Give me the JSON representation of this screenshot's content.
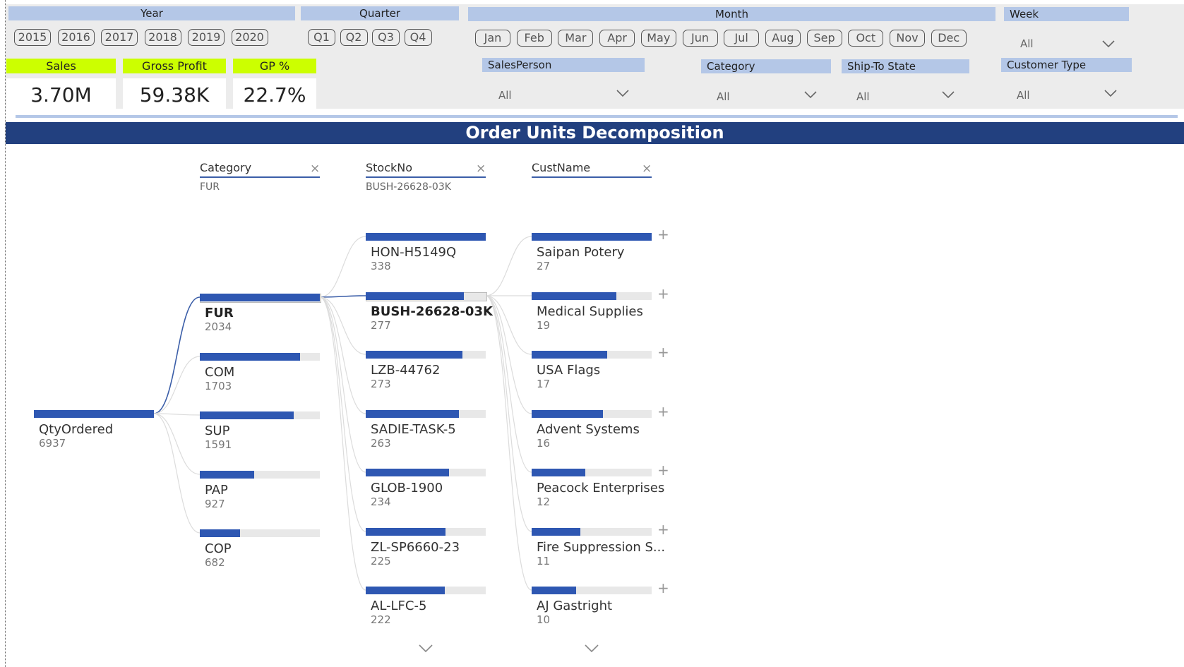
{
  "filters": {
    "year": {
      "title": "Year",
      "options": [
        "2015",
        "2016",
        "2017",
        "2018",
        "2019",
        "2020"
      ]
    },
    "quarter": {
      "title": "Quarter",
      "options": [
        "Q1",
        "Q2",
        "Q3",
        "Q4"
      ]
    },
    "month": {
      "title": "Month",
      "options": [
        "Jan",
        "Feb",
        "Mar",
        "Apr",
        "May",
        "Jun",
        "Jul",
        "Aug",
        "Sep",
        "Oct",
        "Nov",
        "Dec"
      ]
    },
    "week": {
      "title": "Week",
      "value": "All"
    },
    "salesperson": {
      "title": "SalesPerson",
      "value": "All"
    },
    "category": {
      "title": "Category",
      "value": "All"
    },
    "ship_to_state": {
      "title": "Ship-To State",
      "value": "All"
    },
    "customer_type": {
      "title": "Customer Type",
      "value": "All"
    }
  },
  "kpis": [
    {
      "title": "Sales",
      "value": "3.70M"
    },
    {
      "title": "Gross Profit",
      "value": "59.38K"
    },
    {
      "title": "GP %",
      "value": "22.7%"
    }
  ],
  "banner_title": "Order Units Decomposition",
  "tree": {
    "root": {
      "label": "QtyOrdered",
      "value": "6937"
    },
    "levels": [
      {
        "header": "Category",
        "selection": "FUR",
        "nodes": [
          {
            "label": "FUR",
            "value": "2034",
            "selected": true
          },
          {
            "label": "COM",
            "value": "1703"
          },
          {
            "label": "SUP",
            "value": "1591"
          },
          {
            "label": "PAP",
            "value": "927"
          },
          {
            "label": "COP",
            "value": "682"
          }
        ]
      },
      {
        "header": "StockNo",
        "selection": "BUSH-26628-03K",
        "nodes": [
          {
            "label": "HON-H5149Q",
            "value": "338"
          },
          {
            "label": "BUSH-26628-03K",
            "value": "277",
            "selected": true
          },
          {
            "label": "LZB-44762",
            "value": "273"
          },
          {
            "label": "SADIE-TASK-5",
            "value": "263"
          },
          {
            "label": "GLOB-1900",
            "value": "234"
          },
          {
            "label": "ZL-SP6660-23",
            "value": "225"
          },
          {
            "label": "AL-LFC-5",
            "value": "222"
          }
        ]
      },
      {
        "header": "CustName",
        "selection": "",
        "nodes": [
          {
            "label": "Saipan Potery",
            "value": "27"
          },
          {
            "label": "Medical Supplies",
            "value": "19"
          },
          {
            "label": "USA Flags",
            "value": "17"
          },
          {
            "label": "Advent Systems",
            "value": "16"
          },
          {
            "label": "Peacock Enterprises",
            "value": "12"
          },
          {
            "label": "Fire Suppression S...",
            "value": "11"
          },
          {
            "label": "AJ Gastright",
            "value": "10"
          }
        ]
      }
    ]
  },
  "icons": {
    "close": "close-icon",
    "expand": "plus-icon",
    "more": "chevron-down-icon"
  },
  "colors": {
    "bar": "#2e57b2",
    "banner": "#22407f",
    "kpi_title": "#ccff00",
    "slicer_title": "#b4c7e7"
  }
}
